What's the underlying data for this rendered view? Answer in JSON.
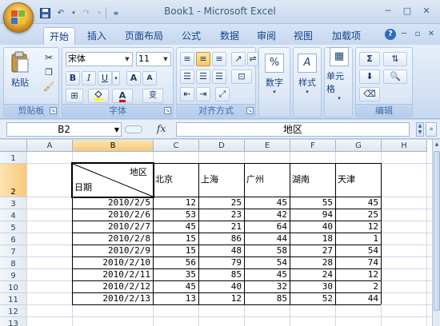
{
  "window": {
    "title": "Book1 - Microsoft Excel"
  },
  "qat": {
    "undo_icon": "undo-icon",
    "redo_icon": "redo-icon"
  },
  "tabs": [
    "开始",
    "插入",
    "页面布局",
    "公式",
    "数据",
    "审阅",
    "视图",
    "加载项"
  ],
  "ribbon": {
    "clipboard": {
      "label": "剪贴板",
      "paste": "粘贴"
    },
    "font": {
      "label": "字体",
      "font_name": "宋体",
      "font_size": "11",
      "bold": "B",
      "italic": "I",
      "underline": "U",
      "grow": "A",
      "shrink": "A",
      "font_color": "A",
      "phonetic": "变"
    },
    "alignment": {
      "label": "对齐方式"
    },
    "number": {
      "label": "数字",
      "percent": "%"
    },
    "styles": {
      "label": "样式"
    },
    "cells": {
      "label": "单元格"
    },
    "editing": {
      "label": "编辑",
      "sigma": "Σ"
    }
  },
  "formula_bar": {
    "name_box": "B2",
    "fx": "fx",
    "content": "地区"
  },
  "columns": [
    "A",
    "B",
    "C",
    "D",
    "E",
    "F",
    "G",
    "H"
  ],
  "rows": [
    "1",
    "2",
    "3",
    "4",
    "5",
    "6",
    "7",
    "8",
    "9",
    "10",
    "11",
    "12",
    "13"
  ],
  "sheet": {
    "diag_top": "地区",
    "diag_bottom": "日期",
    "headers": [
      "北京",
      "上海",
      "广州",
      "湖南",
      "天津"
    ],
    "data": [
      {
        "date": "2010/2/5",
        "values": [
          "12",
          "25",
          "45",
          "55",
          "45"
        ]
      },
      {
        "date": "2010/2/6",
        "values": [
          "53",
          "23",
          "42",
          "94",
          "25"
        ]
      },
      {
        "date": "2010/2/7",
        "values": [
          "45",
          "21",
          "64",
          "40",
          "12"
        ]
      },
      {
        "date": "2010/2/8",
        "values": [
          "15",
          "86",
          "44",
          "18",
          "1"
        ]
      },
      {
        "date": "2010/2/9",
        "values": [
          "15",
          "48",
          "58",
          "27",
          "54"
        ]
      },
      {
        "date": "2010/2/10",
        "values": [
          "56",
          "79",
          "54",
          "28",
          "74"
        ]
      },
      {
        "date": "2010/2/11",
        "values": [
          "35",
          "85",
          "45",
          "24",
          "12"
        ]
      },
      {
        "date": "2010/2/12",
        "values": [
          "45",
          "40",
          "32",
          "30",
          "2"
        ]
      },
      {
        "date": "2010/2/13",
        "values": [
          "13",
          "12",
          "85",
          "52",
          "44"
        ]
      }
    ]
  }
}
